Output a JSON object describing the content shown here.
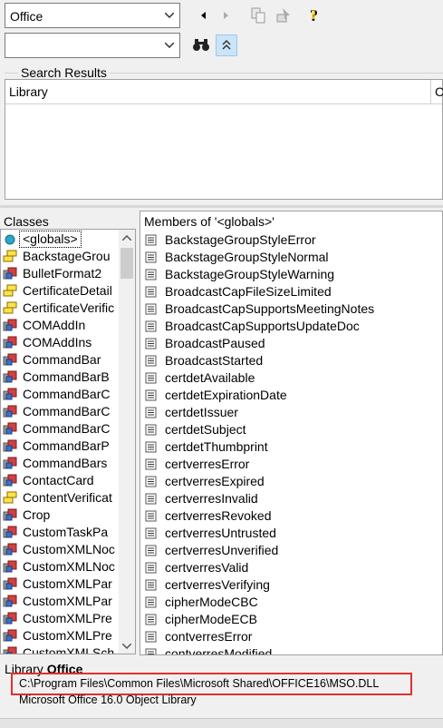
{
  "toolbar": {
    "library_combo_value": "Office",
    "search_combo_value": ""
  },
  "search_results": {
    "title": "Search Results",
    "columns": [
      "Library",
      "C"
    ]
  },
  "classes": {
    "title": "Classes",
    "items": [
      {
        "label": "<globals>",
        "icon": "globals-icon"
      },
      {
        "label": "BackstageGrou",
        "icon": "enum-icon"
      },
      {
        "label": "BulletFormat2",
        "icon": "class-icon"
      },
      {
        "label": "CertificateDetail",
        "icon": "enum-icon"
      },
      {
        "label": "CertificateVerific",
        "icon": "enum-icon"
      },
      {
        "label": "COMAddIn",
        "icon": "class-icon"
      },
      {
        "label": "COMAddIns",
        "icon": "class-icon"
      },
      {
        "label": "CommandBar",
        "icon": "class-icon"
      },
      {
        "label": "CommandBarB",
        "icon": "class-icon"
      },
      {
        "label": "CommandBarC",
        "icon": "class-icon"
      },
      {
        "label": "CommandBarC",
        "icon": "class-icon"
      },
      {
        "label": "CommandBarC",
        "icon": "class-icon"
      },
      {
        "label": "CommandBarP",
        "icon": "class-icon"
      },
      {
        "label": "CommandBars",
        "icon": "class-icon"
      },
      {
        "label": "ContactCard",
        "icon": "class-icon"
      },
      {
        "label": "ContentVerificat",
        "icon": "enum-icon"
      },
      {
        "label": "Crop",
        "icon": "class-icon"
      },
      {
        "label": "CustomTaskPa",
        "icon": "class-icon"
      },
      {
        "label": "CustomXMLNoc",
        "icon": "class-icon"
      },
      {
        "label": "CustomXMLNoc",
        "icon": "class-icon"
      },
      {
        "label": "CustomXMLPar",
        "icon": "class-icon"
      },
      {
        "label": "CustomXMLPar",
        "icon": "class-icon"
      },
      {
        "label": "CustomXMLPre",
        "icon": "class-icon"
      },
      {
        "label": "CustomXMLPre",
        "icon": "class-icon"
      },
      {
        "label": "CustomXMLSch",
        "icon": "class-icon"
      }
    ]
  },
  "members": {
    "title": "Members of '<globals>'",
    "items": [
      "BackstageGroupStyleError",
      "BackstageGroupStyleNormal",
      "BackstageGroupStyleWarning",
      "BroadcastCapFileSizeLimited",
      "BroadcastCapSupportsMeetingNotes",
      "BroadcastCapSupportsUpdateDoc",
      "BroadcastPaused",
      "BroadcastStarted",
      "certdetAvailable",
      "certdetExpirationDate",
      "certdetIssuer",
      "certdetSubject",
      "certdetThumbprint",
      "certverresError",
      "certverresExpired",
      "certverresInvalid",
      "certverresRevoked",
      "certverresUntrusted",
      "certverresUnverified",
      "certverresValid",
      "certverresVerifying",
      "cipherModeCBC",
      "cipherModeECB",
      "contverresError",
      "contverresModified"
    ]
  },
  "details": {
    "library_label": "Library",
    "library_name": "Office",
    "path": "C:\\Program Files\\Common Files\\Microsoft Shared\\OFFICE16\\MSO.DLL",
    "description": "Microsoft Office 16.0 Object Library"
  }
}
